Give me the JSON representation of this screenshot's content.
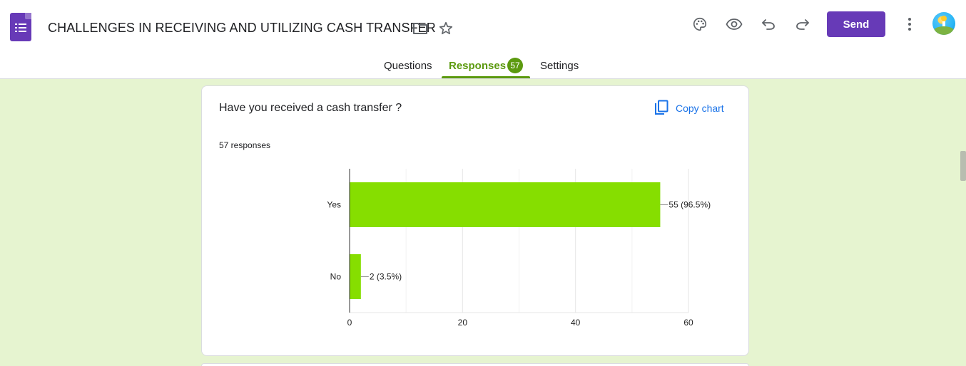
{
  "header": {
    "title": "CHALLENGES IN RECEIVING AND UTILIZING CASH TRANSFER",
    "send_label": "Send",
    "icons": [
      "forms-logo-icon",
      "folder-icon",
      "star-icon",
      "palette-icon",
      "preview-eye-icon",
      "undo-icon",
      "redo-icon",
      "more-vert-icon",
      "avatar"
    ],
    "accent_color": "#673ab7"
  },
  "tabs": [
    {
      "label": "Questions"
    },
    {
      "label": "Responses",
      "badge": "57",
      "active": true
    },
    {
      "label": "Settings"
    }
  ],
  "theme": {
    "background": "#e6f4d0",
    "tab_accent": "#5c9a0f",
    "bar_color": "#86de00"
  },
  "question": {
    "title": "Have you received a cash transfer ?",
    "copy_chart_label": "Copy chart",
    "responses_label": "57 responses"
  },
  "chart_data": {
    "type": "bar",
    "orientation": "horizontal",
    "categories": [
      "Yes",
      "No"
    ],
    "values": [
      55,
      2
    ],
    "data_labels": [
      "55 (96.5%)",
      "2 (3.5%)"
    ],
    "xlim": [
      0,
      60
    ],
    "x_ticks": [
      "0",
      "20",
      "40",
      "60"
    ],
    "grid": true,
    "legend": "none"
  }
}
